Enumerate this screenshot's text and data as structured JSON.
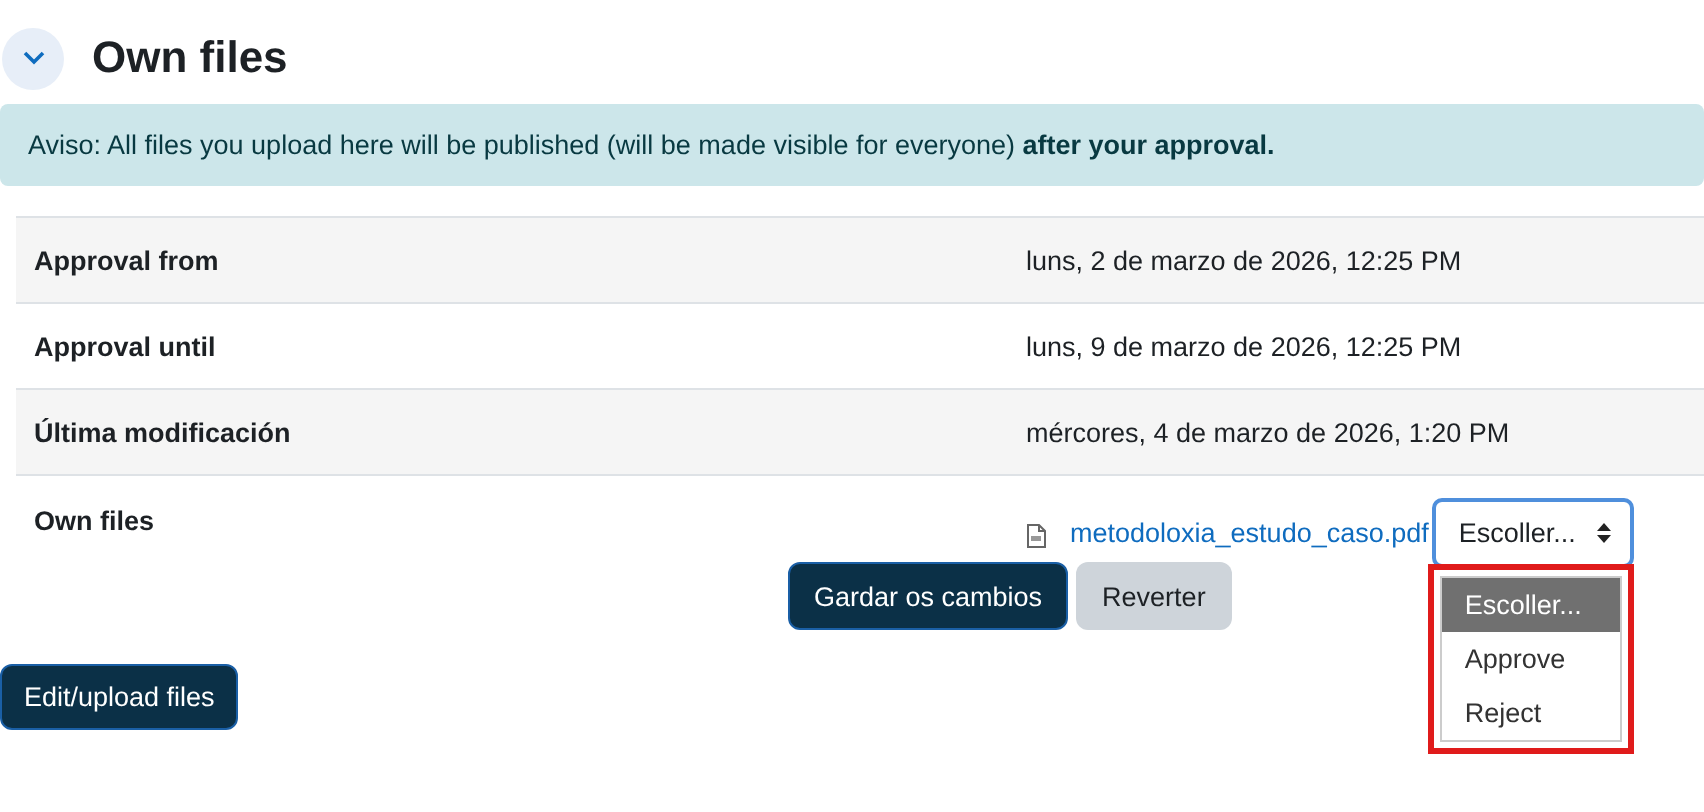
{
  "section": {
    "title": "Own files",
    "expanded": true
  },
  "notice": {
    "text": "Aviso: All files you upload here will be published (will be made visible for everyone) **after your approval.**"
  },
  "rows": [
    {
      "label": "Approval from",
      "value": "luns, 2 de marzo de 2026, 12:25 PM"
    },
    {
      "label": "Approval until",
      "value": "luns, 9 de marzo de 2026, 12:25 PM"
    },
    {
      "label": "Última modificación",
      "value": "mércores, 4 de marzo de 2026, 1:20 PM"
    }
  ],
  "file_row": {
    "label": "Own files",
    "file": "metodoloxia_estudo_caso.pdf",
    "select": {
      "value": "Escoller...",
      "open": true,
      "focused": true,
      "options": [
        {
          "label": "Escoller...",
          "selected": true
        },
        {
          "label": "Approve",
          "selected": false
        },
        {
          "label": "Reject",
          "selected": false
        }
      ]
    }
  },
  "buttons": [
    {
      "label": "Gardar os cambios",
      "kind": "primary"
    },
    {
      "label": "Reverter",
      "kind": "secondary"
    }
  ],
  "edit_button": {
    "label": "Edit/upload files"
  }
}
